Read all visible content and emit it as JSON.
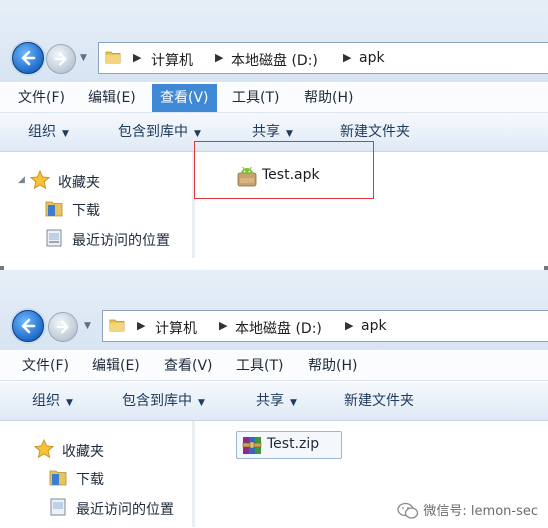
{
  "panels": [
    {
      "breadcrumb": [
        "计算机",
        "本地磁盘 (D:)",
        "apk"
      ],
      "menu": [
        "文件(F)",
        "编辑(E)",
        "查看(V)",
        "工具(T)",
        "帮助(H)"
      ],
      "active_menu_index": 2,
      "commands": [
        "组织",
        "包含到库中",
        "共享",
        "新建文件夹"
      ],
      "nav": {
        "favorites": "收藏夹",
        "downloads": "下载",
        "recent": "最近访问的位置"
      },
      "file": {
        "name": "Test.apk",
        "icon": "android-apk-icon"
      }
    },
    {
      "breadcrumb": [
        "计算机",
        "本地磁盘 (D:)",
        "apk"
      ],
      "menu": [
        "文件(F)",
        "编辑(E)",
        "查看(V)",
        "工具(T)",
        "帮助(H)"
      ],
      "commands": [
        "组织",
        "包含到库中",
        "共享",
        "新建文件夹"
      ],
      "nav": {
        "favorites": "收藏夹",
        "downloads": "下载",
        "recent": "最近访问的位置"
      },
      "file": {
        "name": "Test.zip",
        "icon": "winrar-archive-icon"
      }
    }
  ],
  "watermark": "微信号: lemon-sec",
  "colors": {
    "highlight_box": "#d9363e",
    "menu_active": "#3f88d6"
  }
}
